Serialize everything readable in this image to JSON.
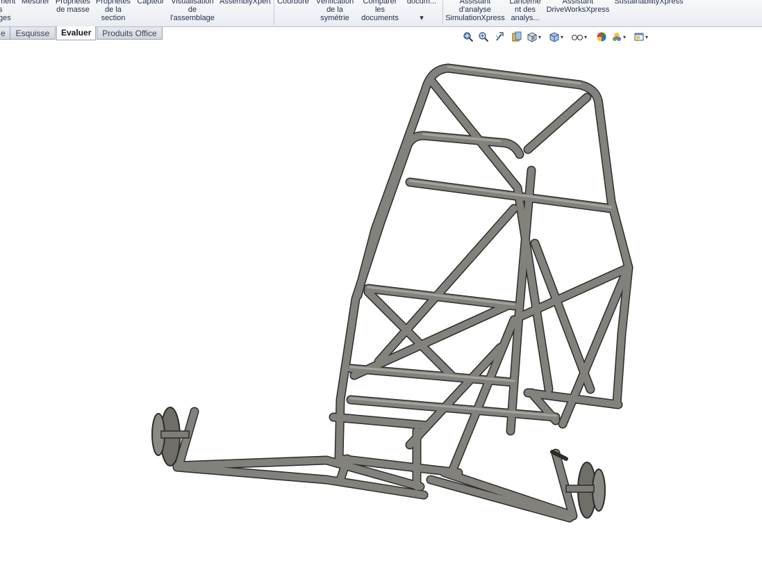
{
  "ribbon": {
    "items": [
      "ment\ns\nges",
      "Mesurer",
      "Propriétés\nde masse",
      "Propriétés\nde la\nsection",
      "Capteur",
      "Visualisation\nde\nl'assemblage",
      "AssemblyXpert",
      "Courbure",
      "Vérification\nde la\nsymétrie",
      "Comparer\nles\ndocuments",
      "docum...\n\n▾",
      "Assistant\nd'analyse\nSimulationXpress",
      "Lanceme\nnt des\nanalys...",
      "Assistant\nDriveWorksXpress",
      "SustainabilityXpress"
    ]
  },
  "tabs": [
    {
      "label": "e",
      "active": false
    },
    {
      "label": "Esquisse",
      "active": false
    },
    {
      "label": "Evaluer",
      "active": true
    },
    {
      "label": "Produits Office",
      "active": false
    }
  ],
  "view_toolbar": {
    "icons": [
      "zoom-to-fit-icon",
      "zoom-to-area-icon",
      "previous-view-icon",
      "section-view-icon",
      "view-orientation-icon",
      "display-style-icon",
      "hide-show-items-icon",
      "edit-appearance-icon",
      "apply-scene-icon",
      "view-settings-icon"
    ]
  },
  "colors": {
    "model_tube": "#7e7d78",
    "model_outline": "#2c2c2a",
    "background": "#ffffff",
    "ribbon_text": "#1f2d4a"
  }
}
